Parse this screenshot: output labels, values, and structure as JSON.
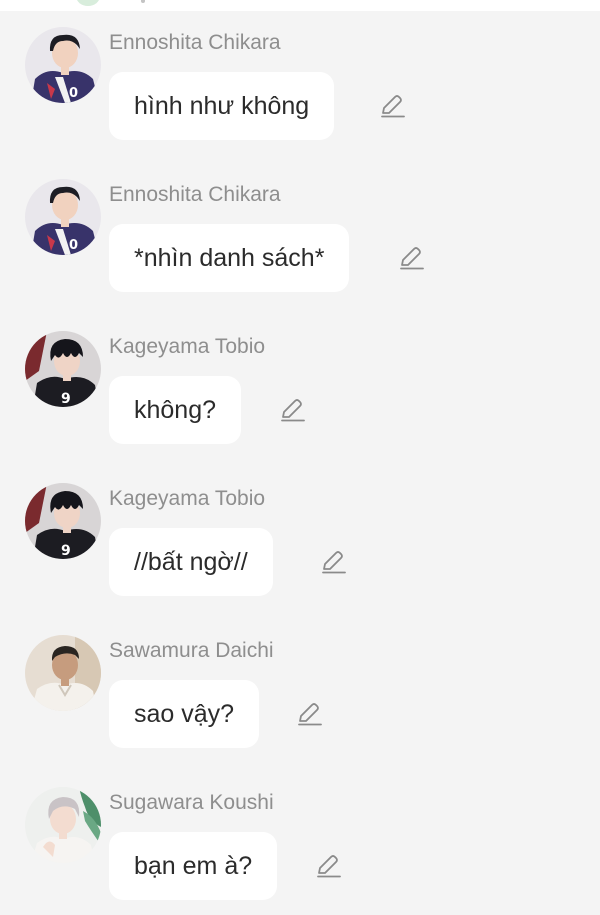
{
  "messages": [
    {
      "sender": "Ennoshita Chikara",
      "text": "hình như không",
      "avatar_icon": "ennoshita-avatar"
    },
    {
      "sender": "Ennoshita Chikara",
      "text": "*nhìn danh sách*",
      "avatar_icon": "ennoshita-avatar"
    },
    {
      "sender": "Kageyama Tobio",
      "text": "không?",
      "avatar_icon": "kageyama-avatar"
    },
    {
      "sender": "Kageyama Tobio",
      "text": "//bất ngờ//",
      "avatar_icon": "kageyama-avatar"
    },
    {
      "sender": "Sawamura Daichi",
      "text": "sao vậy?",
      "avatar_icon": "sawamura-avatar"
    },
    {
      "sender": "Sugawara Koushi",
      "text": "bạn em à?",
      "avatar_icon": "sugawara-avatar"
    }
  ],
  "icons": {
    "edit": "pencil-icon"
  },
  "colors": {
    "background": "#f4f4f4",
    "bubble": "#ffffff",
    "sender_text": "#8e8e8e",
    "message_text": "#2b2b2b",
    "edit_icon": "#8a8a8a"
  }
}
